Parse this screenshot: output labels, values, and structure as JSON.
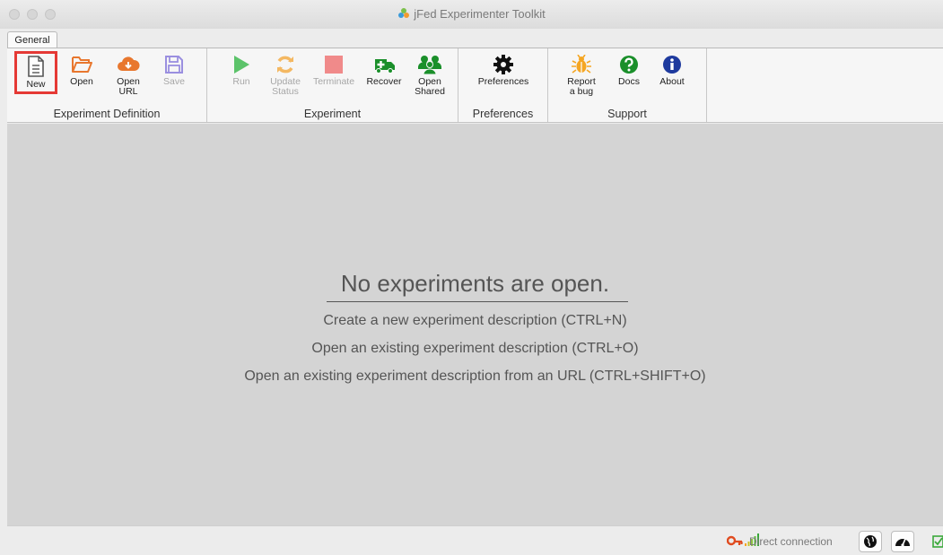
{
  "window": {
    "title": "jFed Experimenter Toolkit"
  },
  "tabs": [
    {
      "label": "General"
    }
  ],
  "ribbon": {
    "groups": [
      {
        "label": "Experiment Definition",
        "buttons": [
          {
            "label": "New"
          },
          {
            "label": "Open"
          },
          {
            "label": "Open URL"
          },
          {
            "label": "Save"
          }
        ]
      },
      {
        "label": "Experiment",
        "buttons": [
          {
            "label": "Run"
          },
          {
            "label": "Update Status"
          },
          {
            "label": "Terminate"
          },
          {
            "label": "Recover"
          },
          {
            "label": "Open Shared"
          }
        ]
      },
      {
        "label": "Preferences",
        "buttons": [
          {
            "label": "Preferences"
          }
        ]
      },
      {
        "label": "Support",
        "buttons": [
          {
            "label": "Report a bug"
          },
          {
            "label": "Docs"
          },
          {
            "label": "About"
          }
        ]
      }
    ]
  },
  "main": {
    "title": "No experiments are open.",
    "hints": [
      "Create a new experiment description (CTRL+N)",
      "Open an existing experiment description (CTRL+O)",
      "Open an existing experiment description from an URL (CTRL+SHIFT+O)"
    ]
  },
  "status": {
    "connection": "Direct connection"
  },
  "colors": {
    "orange": "#e8772e",
    "save_purple": "#9a8fe0",
    "run_green": "#5cc36a",
    "update_orange": "#f4b862",
    "terminate_red": "#f08a8a",
    "green": "#1a8f2a",
    "bug_orange": "#f5a623",
    "highlight_red": "#e53935"
  }
}
